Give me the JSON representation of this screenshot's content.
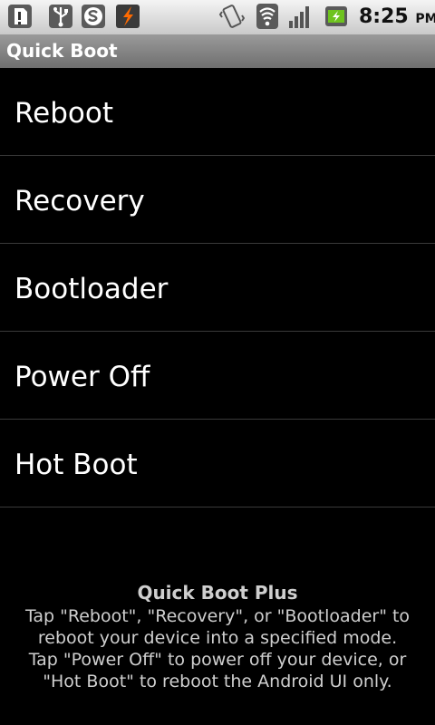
{
  "status_bar": {
    "time": "8:25",
    "ampm": "PM",
    "icons": [
      "sd-card-warning-icon",
      "usb-icon",
      "skype-icon",
      "lightning-app-icon",
      "vibrate-icon",
      "wifi-icon",
      "signal-icon",
      "battery-charging-icon"
    ]
  },
  "title_bar": {
    "title": "Quick Boot"
  },
  "menu": {
    "items": [
      {
        "label": "Reboot"
      },
      {
        "label": "Recovery"
      },
      {
        "label": "Bootloader"
      },
      {
        "label": "Power Off"
      },
      {
        "label": "Hot Boot"
      }
    ]
  },
  "footer": {
    "title": "Quick Boot Plus",
    "lines": [
      "Tap \"Reboot\", \"Recovery\", or \"Bootloader\" to",
      "reboot your device into a specified mode.",
      "Tap \"Power Off\" to power off your device, or",
      "\"Hot Boot\" to reboot the Android UI only."
    ]
  },
  "colors": {
    "background": "#000000",
    "title_bar": "#8a8a8a",
    "divider": "#3a3a3a",
    "footer_text": "#cfcfcf"
  }
}
